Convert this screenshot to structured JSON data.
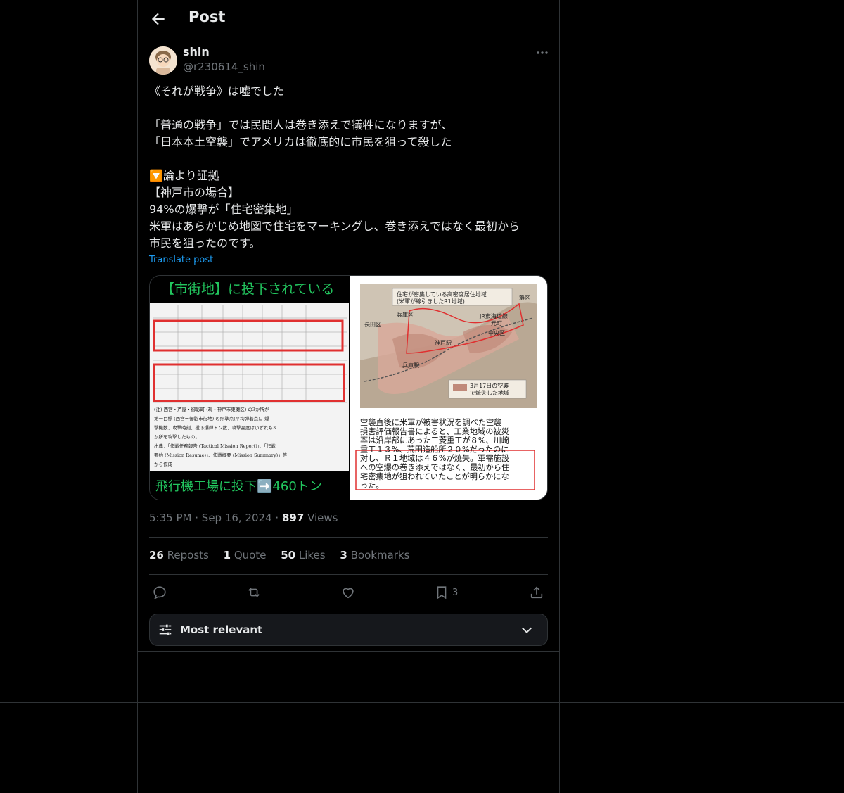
{
  "header": {
    "title": "Post",
    "back_icon": "back-arrow-icon"
  },
  "author": {
    "name": "shin",
    "handle": "@r230614_shin"
  },
  "post": {
    "lines": [
      "《それが戦争》は嘘でした",
      "",
      "「普通の戦争」では民間人は巻き添えで犠牲になりますが、",
      "「日本本土空襲」でアメリカは徹底的に市民を狙って殺した",
      "",
      "🔽論より証拠",
      "【神戸市の場合】",
      "94%の爆撃が「住宅密集地」",
      "米軍はあらかじめ地図で住宅をマーキングし、巻き添えではなく最初から",
      "市民を狙ったのです。"
    ],
    "translate": "Translate post"
  },
  "media": {
    "left_title": "【市街地】に投下されている",
    "left_bottom": "飛行機工場に投下➡️460トン",
    "left_note": [
      "(注) 西宮・芦屋・御影町 (現・神戸市東灘区) の3か所が",
      "第一目標 (西宮ー御影市街地) の照準点(平均弾着点)。爆",
      "撃機数、攻撃時刻、投下爆弾トン数、攻撃高度はいずれも3",
      "か所を攻撃したもの。",
      "出典：「作戦任務報告 (Tactical Mission Report)」、「作戦",
      "要約 (Mission Resume)」、作戦概要 (Mission Summary)」等",
      "から作成"
    ],
    "map_legend_top": [
      "住宅が密集している高密度居住地域",
      "(米軍が線引きしたR1地域)"
    ],
    "map_labels": [
      "灘区",
      "兵庫区",
      "長田区",
      "中央区",
      "神戸駅",
      "JR東海道線",
      "兵庫駅",
      "元町"
    ],
    "map_legend_bottom": [
      "3月17日の空襲",
      "で焼失した地域"
    ],
    "right_caption": [
      "空襲直後に米軍が被害状況を調べた空襲",
      "損害評価報告書によると、工業地域の被災",
      "率は沿岸部にあった三菱重工が８%、川崎",
      "重工１３%、荒田造船所２０%だったのに",
      "対し、Ｒ１地域は４６%が焼失。軍需施設",
      "への空爆の巻き添えではなく、最初から住",
      "宅密集地が狙われていたことが明らかにな",
      "った。"
    ]
  },
  "meta": {
    "time": "5:35 PM",
    "date": "Sep 16, 2024",
    "views_count": "897",
    "views_label": "Views",
    "sep": "·"
  },
  "stats": [
    {
      "count": "26",
      "label": "Reposts"
    },
    {
      "count": "1",
      "label": "Quote"
    },
    {
      "count": "50",
      "label": "Likes"
    },
    {
      "count": "3",
      "label": "Bookmarks"
    }
  ],
  "actions": {
    "bookmark_count": "3"
  },
  "sort": {
    "label": "Most relevant"
  },
  "colors": {
    "accent": "#1d9bf0",
    "border": "#2f3336",
    "muted": "#71767b",
    "table_red": "#e03030",
    "title_green": "#22c55e"
  }
}
